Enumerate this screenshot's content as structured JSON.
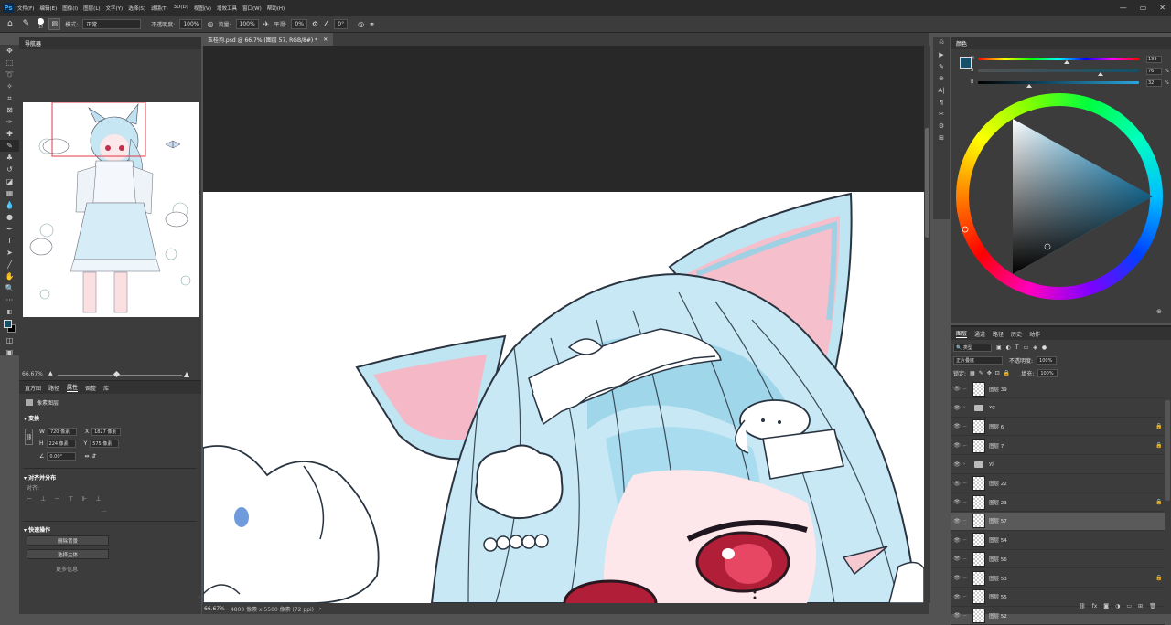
{
  "app": {
    "logo": "Ps"
  },
  "menu": [
    "文件(F)",
    "编辑(E)",
    "图像(I)",
    "图层(L)",
    "文字(Y)",
    "选择(S)",
    "滤镜(T)",
    "3D(D)",
    "视图(V)",
    "增效工具",
    "窗口(W)",
    "帮助(H)"
  ],
  "options": {
    "brush_size": "17",
    "mode_label": "模式:",
    "mode_value": "正常",
    "opacity_label": "不透明度:",
    "opacity_value": "100%",
    "flow_label": "流量:",
    "flow_value": "100%",
    "smooth_label": "平滑:",
    "smooth_value": "0%",
    "angle_value": "0°"
  },
  "navigator": {
    "title": "导航器",
    "zoom": "66.67%"
  },
  "properties": {
    "tabs": [
      "直方图",
      "路径",
      "属性",
      "调整",
      "库"
    ],
    "active_tab": "属性",
    "layer_kind": "像素图层",
    "transform_title": "变换",
    "w_label": "W",
    "w_value": "720 像素",
    "x_label": "X",
    "x_value": "1827 像素",
    "h_label": "H",
    "h_value": "224 像素",
    "y_label": "Y",
    "y_value": "575 像素",
    "angle_value": "0.00°",
    "align_title": "对齐并分布",
    "align_sub": "对齐:",
    "more": "···",
    "quick_title": "快速操作",
    "btn_remove_bg": "删除背景",
    "btn_select_subject": "选择主体",
    "more_link": "更多信息"
  },
  "document": {
    "tab_title": "玉桂狗.psd @ 66.7% (图层 57, RGB/8#) *",
    "status_zoom": "66.67%",
    "status_size": "4800 像素 x 5500 像素 (72 ppi)"
  },
  "color": {
    "title": "颜色",
    "h_label": "H",
    "h_value": "199",
    "s_label": "S",
    "s_value": "76",
    "b_label": "B",
    "b_value": "32",
    "pct": "%",
    "h_frac": 0.55,
    "s_frac": 0.76,
    "b_frac": 0.32,
    "fg": "#14506a",
    "bg": "#000000"
  },
  "layers": {
    "tabs": [
      "图层",
      "通道",
      "路径",
      "历史",
      "动作"
    ],
    "active_tab": "图层",
    "filter": "类型",
    "blend": "正片叠底",
    "opacity_label": "不透明度:",
    "opacity_value": "100%",
    "lock_label": "锁定:",
    "fill_label": "填充:",
    "fill_value": "100%",
    "items": [
      {
        "name": "图层 39",
        "type": "layer",
        "lock": false
      },
      {
        "name": "xg",
        "type": "group",
        "lock": false
      },
      {
        "name": "图层 6",
        "type": "layer",
        "lock": true
      },
      {
        "name": "图层 7",
        "type": "layer",
        "lock": true
      },
      {
        "name": "yj",
        "type": "group",
        "lock": false
      },
      {
        "name": "图层 22",
        "type": "layer",
        "lock": false
      },
      {
        "name": "图层 23",
        "type": "layer",
        "lock": true
      },
      {
        "name": "图层 57",
        "type": "layer",
        "lock": false,
        "selected": true
      },
      {
        "name": "图层 54",
        "type": "layer",
        "lock": false
      },
      {
        "name": "图层 56",
        "type": "layer",
        "lock": false
      },
      {
        "name": "图层 53",
        "type": "layer",
        "lock": true
      },
      {
        "name": "图层 55",
        "type": "layer",
        "lock": false
      },
      {
        "name": "图层 52",
        "type": "layer",
        "lock": false
      }
    ],
    "footer_fx": "fx"
  }
}
